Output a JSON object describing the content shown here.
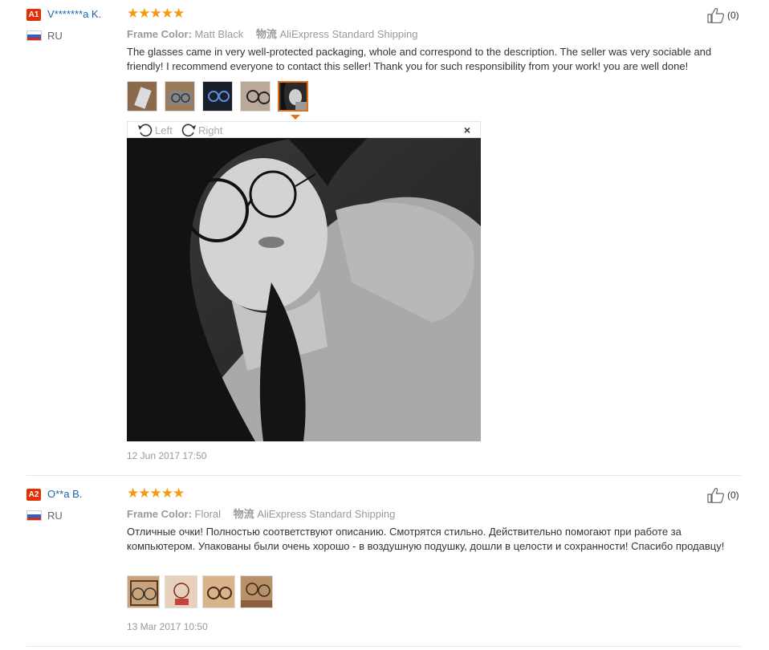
{
  "reviews": [
    {
      "badge": "A1",
      "username": "V*******a K.",
      "country": "RU",
      "stars": "★★★★★",
      "attr_label": "Frame Color:",
      "attr_value": "Matt Black",
      "ship_label": "物流",
      "ship_value": "AliExpress Standard Shipping",
      "text": "The glasses came in very well-protected packaging, whole and correspond to the description. The seller was very sociable and friendly! I recommend everyone to contact this seller! Thank you for such responsibility from your work! you are well done!",
      "likes": "(0)",
      "date": "12 Jun 2017 17:50",
      "viewer": {
        "rotate_left": "Left",
        "rotate_right": "Right",
        "close": "×"
      }
    },
    {
      "badge": "A2",
      "username": "O**a B.",
      "country": "RU",
      "stars": "★★★★★",
      "attr_label": "Frame Color:",
      "attr_value": "Floral",
      "ship_label": "物流",
      "ship_value": "AliExpress Standard Shipping",
      "text": "Отличные очки! Полностью соответствуют описанию. Смотрятся стильно. Действительно помогают при работе за компьютером. Упакованы были очень хорошо - в воздушную подушку, дошли в целости и сохранности! Спасибо продавцу!",
      "likes": "(0)",
      "date": "13 Mar 2017 10:50"
    }
  ],
  "colors": {
    "accent": "#e46f18",
    "star": "#f59a0e",
    "username": "#1a64a8",
    "badge": "#e62e04"
  }
}
